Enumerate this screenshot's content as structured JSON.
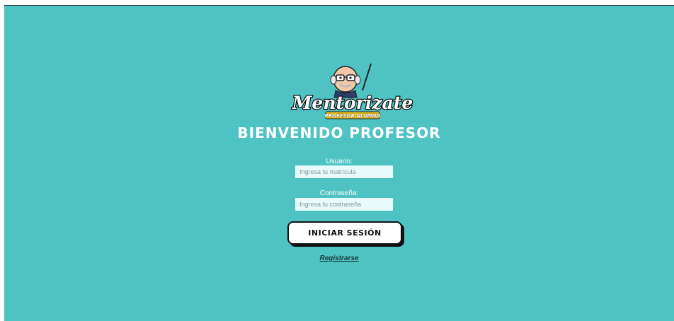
{
  "logo": {
    "brand_text": "Mentorizate",
    "sub_text": "PROFESOR ALUMNO",
    "mascot_icon": "professor-mascot-icon"
  },
  "heading": "BIENVENIDO PROFESOR",
  "form": {
    "user_label": "Usuario:",
    "user_placeholder": "Ingresa tu matrícula",
    "password_label": "Contraseña:",
    "password_placeholder": "Ingresa tu contraseña",
    "login_label": "INICIAR SESIÓN",
    "register_label": "Registrarse"
  },
  "colors": {
    "background": "#4fc2c3",
    "input_background": "#e6fbfb",
    "button_background": "#ffffff",
    "logo_yellow": "#f3c318"
  }
}
